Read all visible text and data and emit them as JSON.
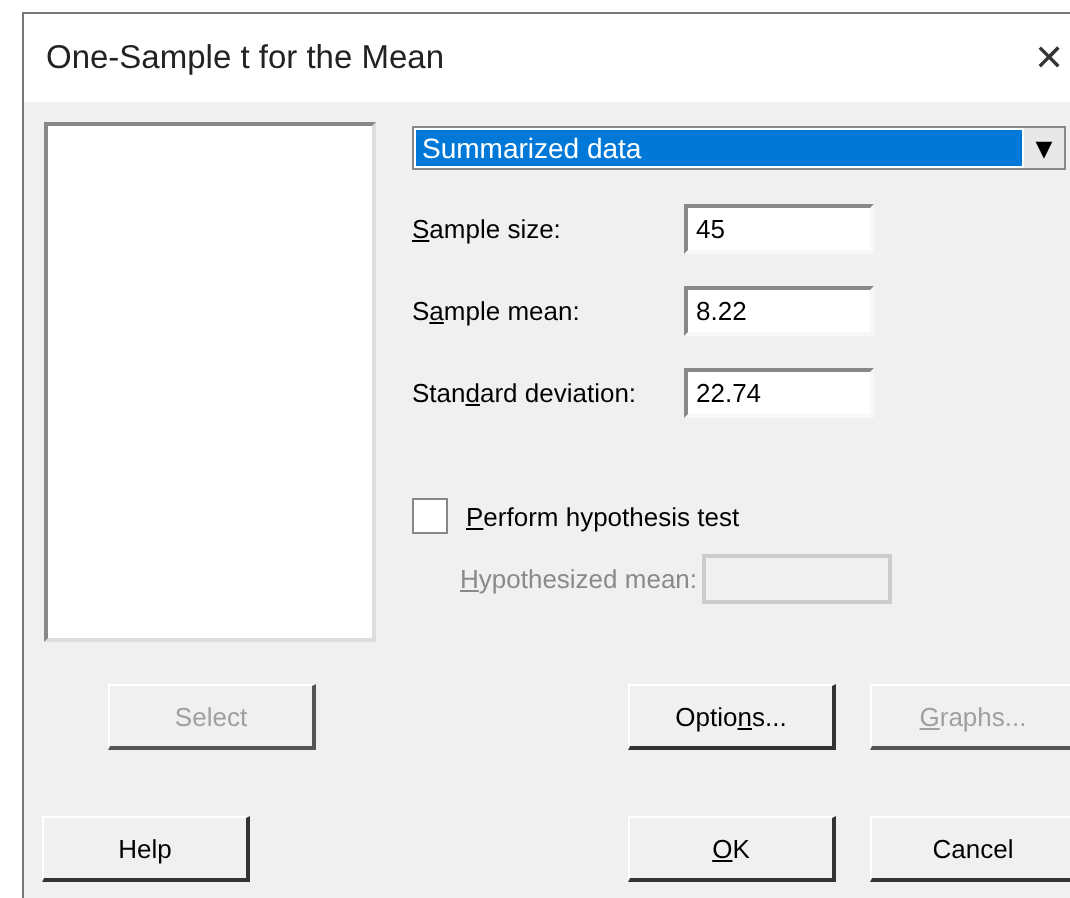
{
  "window": {
    "title": "One-Sample t for the Mean",
    "close": "✕"
  },
  "data_source": {
    "value": "Summarized data",
    "arrow": "▼"
  },
  "fields": [
    {
      "label": {
        "key": "S",
        "after": "ample size:"
      },
      "value": "45"
    },
    {
      "label": {
        "before": "S",
        "key": "a",
        "after": "mple mean:"
      },
      "value": "8.22"
    },
    {
      "label": {
        "before": "Stan",
        "key": "d",
        "after": "ard deviation:"
      },
      "value": "22.74"
    }
  ],
  "hypothesis_test": {
    "checked": false,
    "label": {
      "key": "P",
      "after": "erform hypothesis test"
    }
  },
  "hypothesized_mean": {
    "disabled": true,
    "label": {
      "key": "H",
      "after": "ypothesized mean:"
    }
  },
  "buttons_top": [
    {
      "label": {
        "before": "Select"
      },
      "disabled": true
    },
    {
      "label": {
        "before": "Optio",
        "key": "n",
        "after": "s..."
      },
      "disabled": false
    },
    {
      "label": {
        "key": "G",
        "after": "raphs..."
      },
      "disabled": true
    }
  ],
  "buttons_bottom": [
    {
      "label": {
        "before": "Help"
      },
      "disabled": false
    },
    {
      "label": {
        "key": "O",
        "after": "K"
      },
      "disabled": false
    },
    {
      "label": {
        "before": "Cancel"
      },
      "disabled": false
    }
  ]
}
